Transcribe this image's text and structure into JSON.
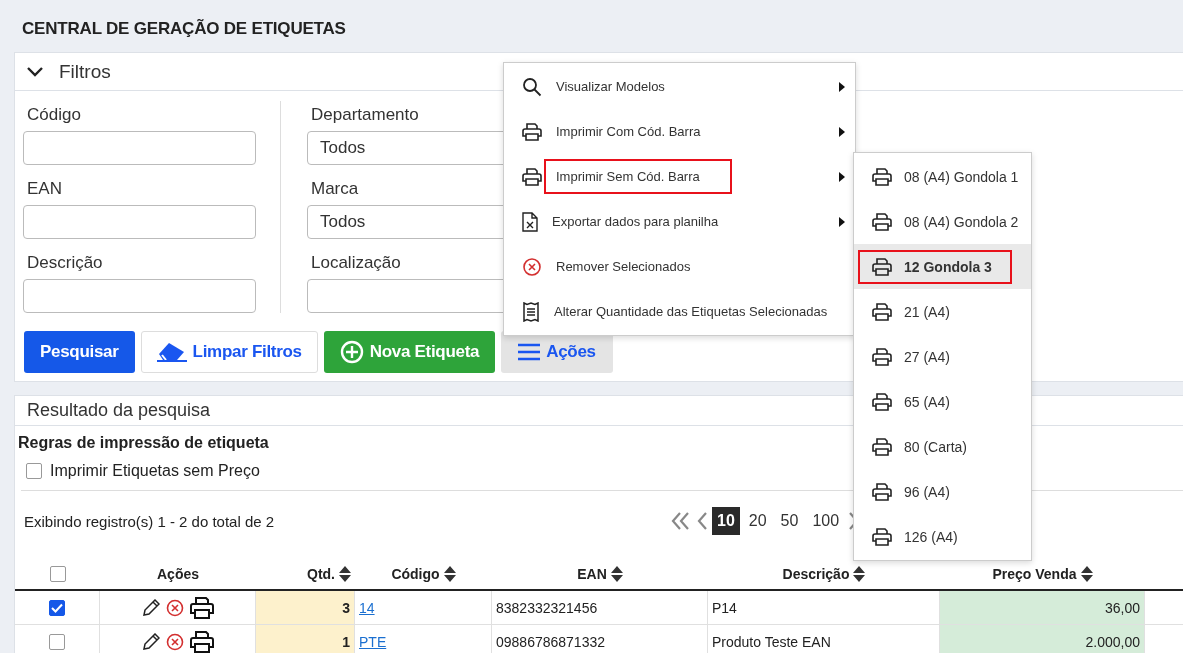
{
  "page_title": "CENTRAL DE GERAÇÃO DE ETIQUETAS",
  "filters": {
    "title": "Filtros",
    "expanded": true,
    "left_fields": [
      {
        "label": "Código"
      },
      {
        "label": "EAN"
      },
      {
        "label": "Descrição"
      }
    ],
    "right_fields": [
      {
        "label": "Departamento",
        "value": "Todos"
      },
      {
        "label": "Marca",
        "value": "Todos"
      },
      {
        "label": "Localização"
      }
    ],
    "buttons": [
      {
        "label": "Pesquisar",
        "kind": "primary"
      },
      {
        "label": "Limpar Filtros",
        "kind": "clear"
      },
      {
        "label": "Nova Etiqueta",
        "kind": "new"
      },
      {
        "label": "Ações",
        "kind": "menu"
      }
    ]
  },
  "actions_menu": [
    {
      "label": "Visualizar Modelos",
      "kind": "search",
      "submenu": true,
      "highlighted": false
    },
    {
      "label": "Imprimir Com Cód. Barra",
      "kind": "print",
      "submenu": true,
      "highlighted": false
    },
    {
      "label": "Imprimir Sem Cód. Barra",
      "kind": "print",
      "submenu": true,
      "highlighted": true
    },
    {
      "label": "Exportar dados para planilha",
      "kind": "export",
      "submenu": true,
      "highlighted": false
    },
    {
      "label": "Remover Selecionados",
      "kind": "remove",
      "submenu": false,
      "highlighted": false
    },
    {
      "label": "Alterar Quantidade das Etiquetas Selecionadas",
      "kind": "receipt",
      "submenu": false,
      "highlighted": false
    }
  ],
  "print_submenu": [
    {
      "label": "08 (A4) Gondola 1",
      "selected": false,
      "highlighted": false
    },
    {
      "label": "08 (A4) Gondola 2",
      "selected": false,
      "highlighted": false
    },
    {
      "label": "12 Gondola 3",
      "selected": true,
      "highlighted": true
    },
    {
      "label": "21 (A4)",
      "selected": false,
      "highlighted": false
    },
    {
      "label": "27 (A4)",
      "selected": false,
      "highlighted": false
    },
    {
      "label": "65 (A4)",
      "selected": false,
      "highlighted": false
    },
    {
      "label": "80 (Carta)",
      "selected": false,
      "highlighted": false
    },
    {
      "label": "96 (A4)",
      "selected": false,
      "highlighted": false
    },
    {
      "label": "126 (A4)",
      "selected": false,
      "highlighted": false
    }
  ],
  "results": {
    "title": "Resultado da pesquisa",
    "rules_title": "Regras de impressão de etiqueta",
    "rules": [
      {
        "label": "Imprimir Etiquetas sem Preço",
        "checked": false
      }
    ],
    "record_info": "Exibindo registro(s) 1 - 2 do total de 2",
    "page_sizes": [
      {
        "label": "10",
        "selected": true
      },
      {
        "label": "20",
        "selected": false
      },
      {
        "label": "50",
        "selected": false
      },
      {
        "label": "100",
        "selected": false
      }
    ],
    "select_all": false,
    "columns": [
      {
        "label": "Ações",
        "sortable": false
      },
      {
        "label": "Qtd.",
        "sortable": true
      },
      {
        "label": "Código",
        "sortable": true
      },
      {
        "label": "EAN",
        "sortable": true
      },
      {
        "label": "Descrição",
        "sortable": true
      },
      {
        "label": "Preço Venda",
        "sortable": true
      }
    ],
    "rows": [
      {
        "checked": true,
        "qty": "3",
        "code": "14",
        "ean": "8382332321456",
        "description": "P14",
        "price": "36,00"
      },
      {
        "checked": false,
        "qty": "1",
        "code": "PTE",
        "ean": "09886786871332",
        "description": "Produto Teste EAN",
        "price": "2.000,00"
      }
    ]
  }
}
